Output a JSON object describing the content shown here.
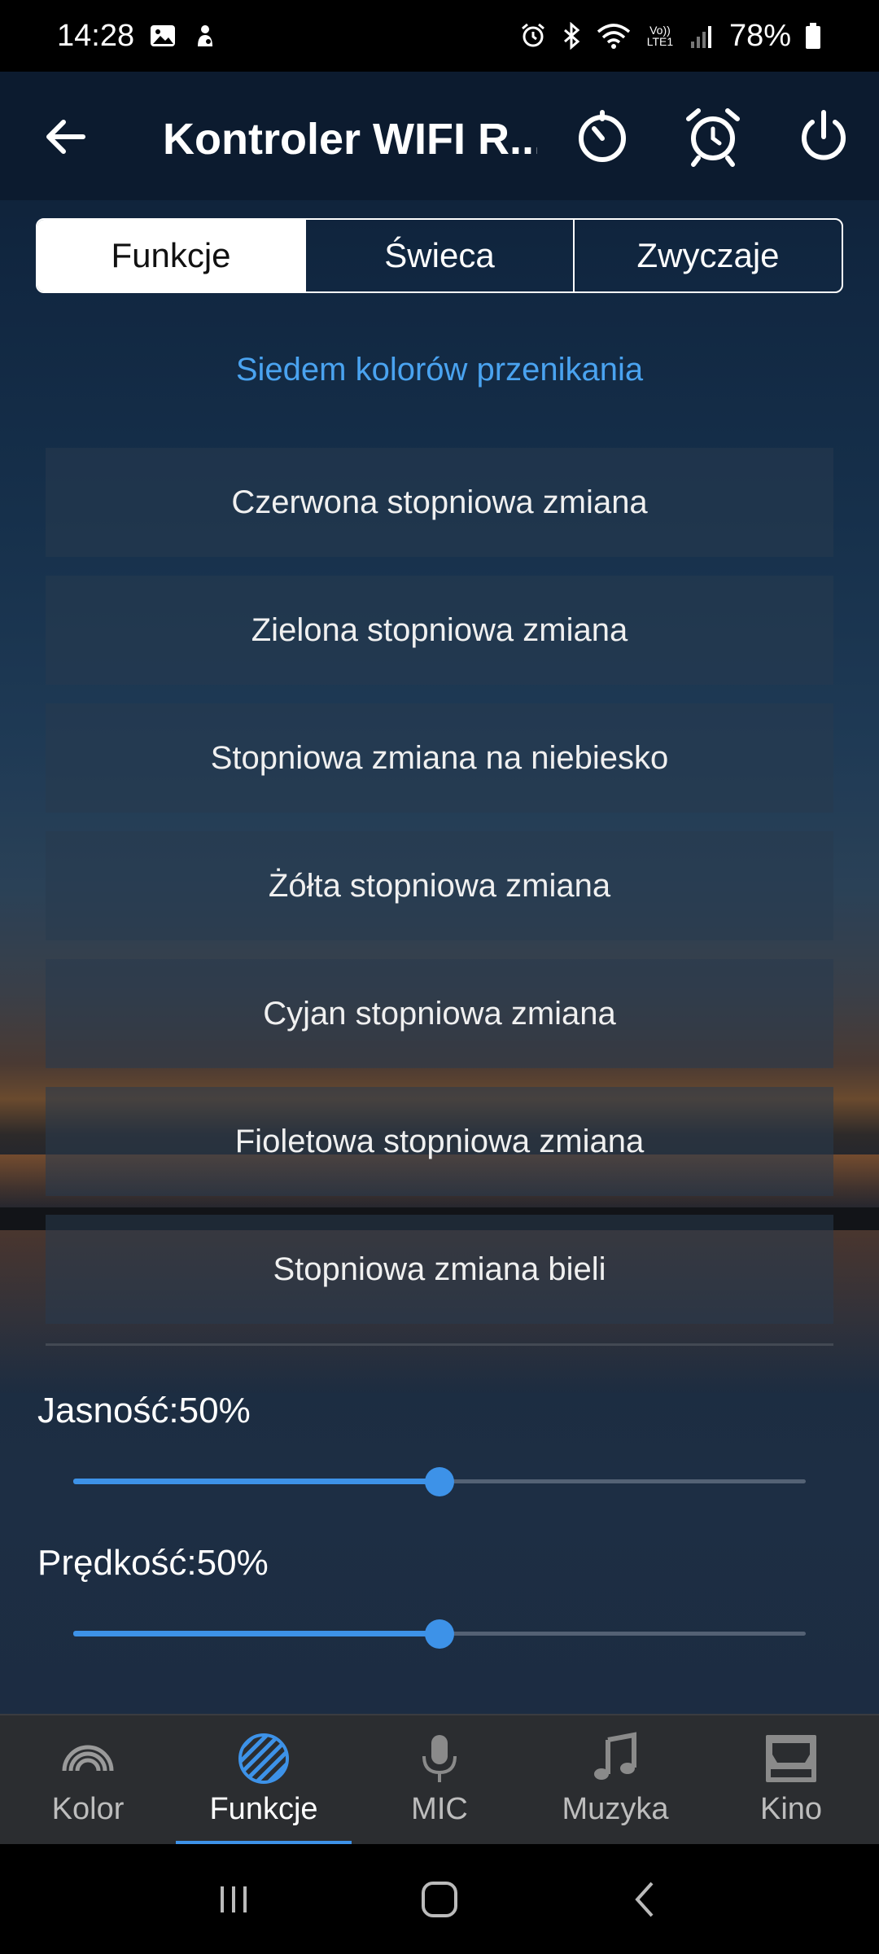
{
  "status_bar": {
    "time": "14:28",
    "network_label": "Vo)) LTE1",
    "battery": "78%"
  },
  "header": {
    "title": "Kontroler WIFI R...",
    "icons": [
      "back-arrow-icon",
      "timer-icon",
      "alarm-clock-icon",
      "power-icon"
    ]
  },
  "tabs": [
    {
      "label": "Funkcje",
      "active": true
    },
    {
      "label": "Świeca",
      "active": false
    },
    {
      "label": "Zwyczaje",
      "active": false
    }
  ],
  "section_title": "Siedem kolorów przenikania",
  "modes": [
    "Czerwona stopniowa zmiana",
    "Zielona stopniowa zmiana",
    "Stopniowa zmiana na niebiesko",
    "Żółta stopniowa zmiana",
    "Cyjan stopniowa zmiana",
    "Fioletowa stopniowa zmiana",
    "Stopniowa zmiana bieli"
  ],
  "brightness": {
    "label": "Jasność:50%",
    "value": 0.5
  },
  "speed": {
    "label": "Prędkość:50%",
    "value": 0.5
  },
  "bottom_nav": [
    {
      "label": "Kolor",
      "icon": "rainbow-icon",
      "active": false
    },
    {
      "label": "Funkcje",
      "icon": "striped-circle-icon",
      "active": true
    },
    {
      "label": "MIC",
      "icon": "microphone-icon",
      "active": false
    },
    {
      "label": "Muzyka",
      "icon": "music-note-icon",
      "active": false
    },
    {
      "label": "Kino",
      "icon": "cinema-screen-icon",
      "active": false
    }
  ],
  "colors": {
    "accent": "#3d92e8",
    "section_title": "#4aa3f0",
    "header_bg": "#0c1b2f",
    "nav_bg": "#2b2d30"
  }
}
